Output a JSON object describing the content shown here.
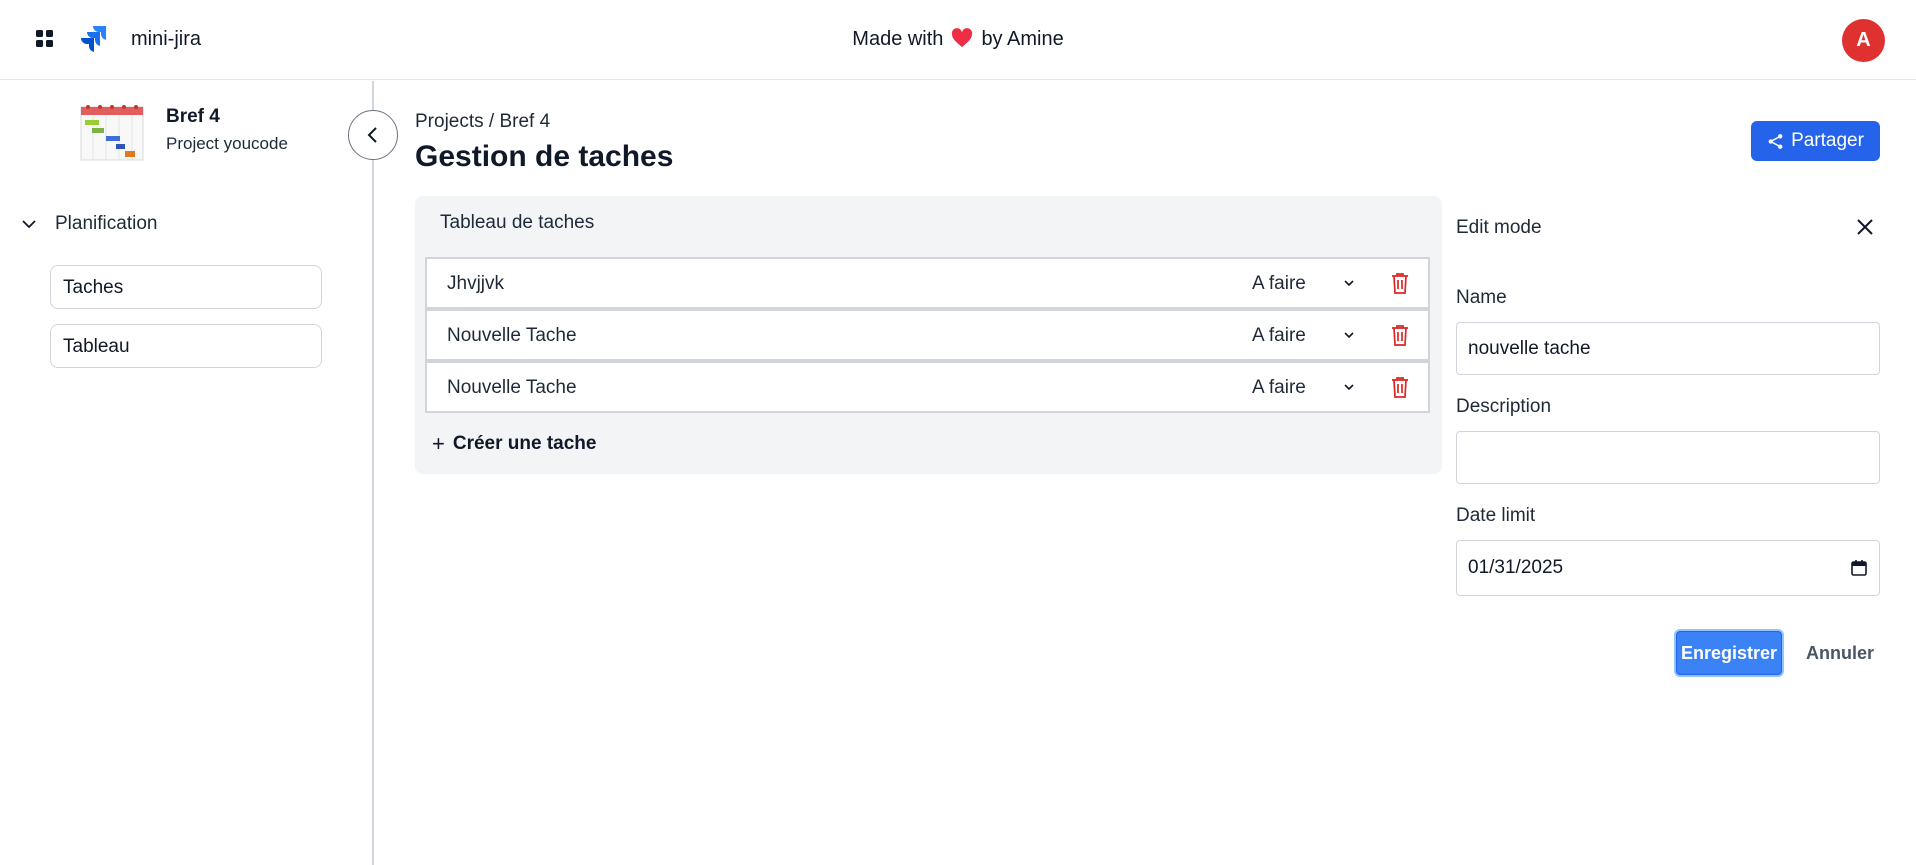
{
  "header": {
    "app_name": "mini-jira",
    "made_with_prefix": "Made with",
    "made_with_suffix": "by Amine",
    "avatar_initial": "A",
    "icons": [
      "apps-grid-icon",
      "jira-logo-icon",
      "heart-icon"
    ]
  },
  "sidebar": {
    "project_name": "Bref 4",
    "project_subtitle": "Project youcode",
    "section_label": "Planification",
    "items": [
      {
        "label": "Taches"
      },
      {
        "label": "Tableau"
      }
    ]
  },
  "main": {
    "breadcrumb": "Projects / Bref 4",
    "title": "Gestion de taches",
    "share_label": "Partager",
    "board_title": "Tableau de taches",
    "tasks": [
      {
        "name": "Jhvjjvk",
        "status": "A faire"
      },
      {
        "name": "Nouvelle Tache",
        "status": "A faire"
      },
      {
        "name": "Nouvelle Tache",
        "status": "A faire"
      }
    ],
    "create_label": "Créer une tache"
  },
  "edit_panel": {
    "title": "Edit mode",
    "name_label": "Name",
    "name_value": "nouvelle tache",
    "description_label": "Description",
    "description_value": "",
    "date_label": "Date limit",
    "date_value": "01/31/2025",
    "save_label": "Enregistrer",
    "cancel_label": "Annuler"
  },
  "colors": {
    "primary": "#2563eb",
    "save": "#3b82f6",
    "avatar": "#e03131",
    "delete": "#dc2626",
    "board_bg": "#f3f4f6"
  }
}
